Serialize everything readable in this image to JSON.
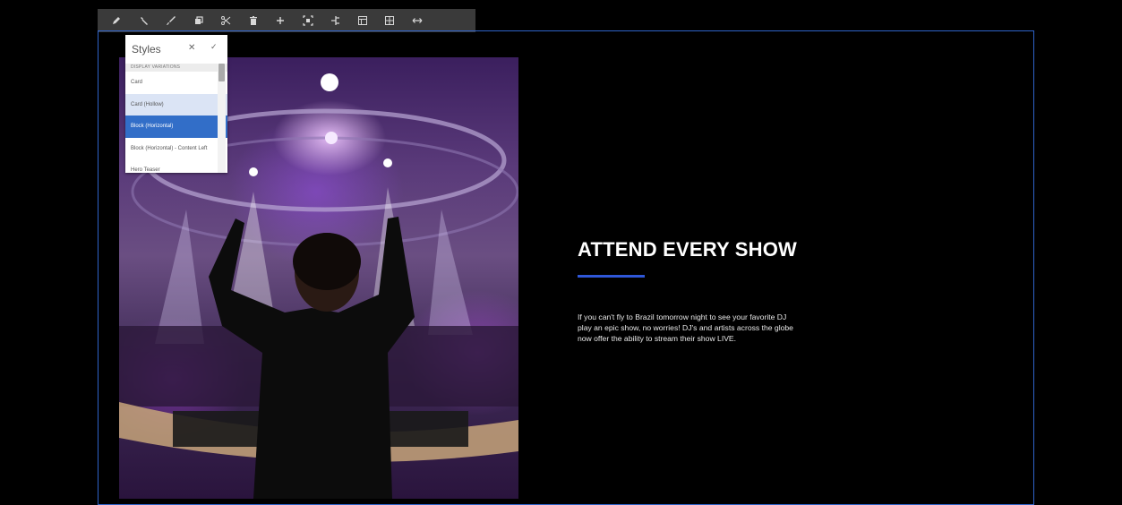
{
  "toolbar": {
    "tools": [
      {
        "name": "edit-icon",
        "glyph": "pencil"
      },
      {
        "name": "configure-icon",
        "glyph": "wrench"
      },
      {
        "name": "styles-icon",
        "glyph": "brush"
      },
      {
        "name": "copy-icon",
        "glyph": "copy"
      },
      {
        "name": "cut-icon",
        "glyph": "scissors"
      },
      {
        "name": "delete-icon",
        "glyph": "trash"
      },
      {
        "name": "insert-icon",
        "glyph": "plus"
      },
      {
        "name": "select-parent-icon",
        "glyph": "frame"
      },
      {
        "name": "group-icon",
        "glyph": "tree"
      },
      {
        "name": "layout-icon",
        "glyph": "layout"
      },
      {
        "name": "grid-icon",
        "glyph": "grid"
      },
      {
        "name": "resize-icon",
        "glyph": "arrows"
      }
    ]
  },
  "styles_popover": {
    "title": "Styles",
    "close_glyph": "✕",
    "confirm_glyph": "✓",
    "group_label": "DISPLAY VARIATIONS",
    "items": [
      {
        "label": "Card",
        "state": "normal"
      },
      {
        "label": "Card (Hollow)",
        "state": "hover"
      },
      {
        "label": "Block (Horizontal)",
        "state": "selected"
      },
      {
        "label": "Block (Horizontal) - Content Left",
        "state": "normal"
      },
      {
        "label": "Hero Teaser",
        "state": "normal"
      }
    ]
  },
  "content": {
    "headline": "ATTEND EVERY SHOW",
    "body": "If you can't fly to Brazil tomorrow night to see your favorite DJ play an epic show, no worries! DJ's and artists across the globe now offer the ability to stream their show LIVE."
  },
  "colors": {
    "accent": "#2f57d8",
    "selection": "#326ec8",
    "frame": "#2f63c9",
    "toolbar": "#3a3a3a"
  }
}
